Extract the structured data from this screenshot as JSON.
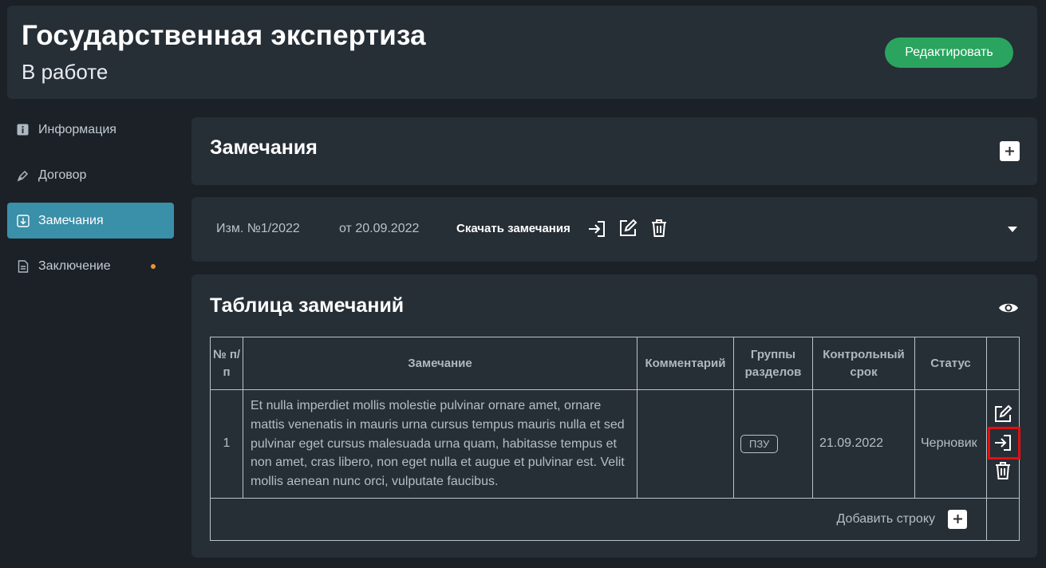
{
  "header": {
    "title": "Государственная экспертиза",
    "status": "В работе",
    "edit_label": "Редактировать"
  },
  "sidebar": {
    "items": [
      {
        "label": "Информация",
        "icon": "info-icon"
      },
      {
        "label": "Договор",
        "icon": "pen-icon"
      },
      {
        "label": "Замечания",
        "icon": "download-box-icon",
        "active": true
      },
      {
        "label": "Заключение",
        "icon": "document-icon",
        "has_dot": true
      }
    ]
  },
  "remarks_section": {
    "title": "Замечания"
  },
  "change": {
    "number": "Изм. №1/2022",
    "date": "от 20.09.2022",
    "download_label": "Скачать замечания"
  },
  "table_section": {
    "title": "Таблица замечаний",
    "columns": {
      "num": "№ п/п",
      "remark": "Замечание",
      "comment": "Комментарий",
      "groups": "Группы разделов",
      "deadline": "Контрольный срок",
      "status": "Статус"
    },
    "rows": [
      {
        "num": "1",
        "remark": "Et nulla imperdiet mollis molestie pulvinar ornare amet, ornare mattis venenatis in mauris urna cursus tempus mauris nulla et sed pulvinar eget cursus malesuada urna quam, habitasse tempus et non amet, cras libero, non eget nulla et augue et pulvinar est. Velit mollis aenean nunc orci, vulputate faucibus.",
        "comment": "",
        "group_tag": "ПЗУ",
        "deadline": "21.09.2022",
        "status": "Черновик"
      }
    ],
    "add_row_label": "Добавить строку"
  },
  "colors": {
    "background": "#1b2127",
    "card": "#262e36",
    "accent_green": "#2aa45f",
    "active_nav": "#3a8fa9",
    "dot": "#e8962e",
    "highlight": "#e31010"
  }
}
